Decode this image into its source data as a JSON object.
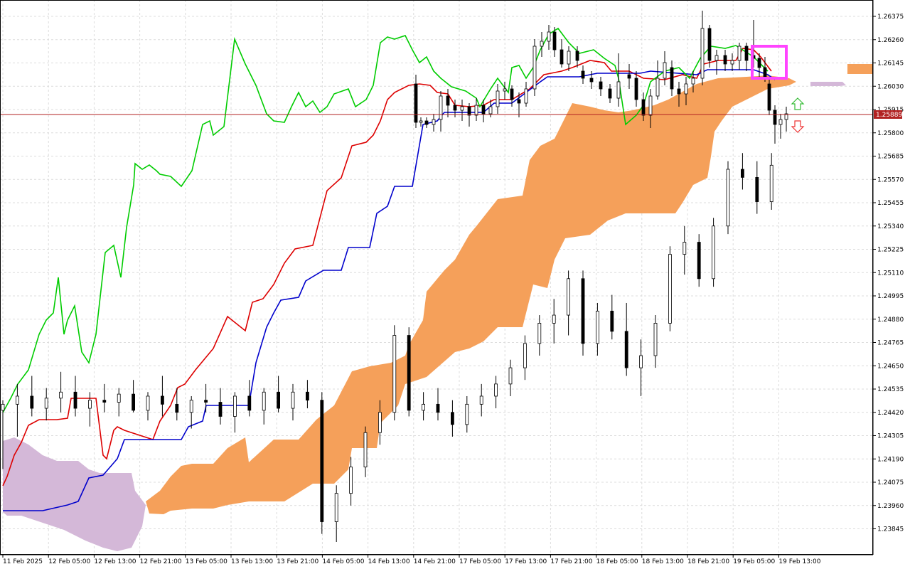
{
  "chart_data": {
    "type": "candlestick",
    "indicator": "ichimoku",
    "y_axis": {
      "ticks": [
        "1.26375",
        "1.26260",
        "1.26145",
        "1.26030",
        "1.25915",
        "1.25800",
        "1.25685",
        "1.25570",
        "1.25455",
        "1.25340",
        "1.25225",
        "1.25110",
        "1.24995",
        "1.24880",
        "1.24765",
        "1.24650",
        "1.24535",
        "1.24420",
        "1.24305",
        "1.24190",
        "1.24075",
        "1.23960",
        "1.23845"
      ],
      "range": [
        1.2376,
        1.2644
      ]
    },
    "x_axis": {
      "ticks": [
        "11 Feb 2025",
        "12 Feb 05:00",
        "12 Feb 13:00",
        "12 Feb 21:00",
        "13 Feb 05:00",
        "13 Feb 13:00",
        "13 Feb 21:00",
        "14 Feb 05:00",
        "14 Feb 13:00",
        "14 Feb 21:00",
        "17 Feb 05:00",
        "17 Feb 13:00",
        "17 Feb 21:00",
        "18 Feb 05:00",
        "18 Feb 13:00",
        "18 Feb 21:00",
        "19 Feb 05:00",
        "19 Feb 13:00"
      ],
      "bars": 220
    },
    "current_price": "1.25889",
    "grid": true,
    "colors": {
      "kumo_bull": "#f5a05a",
      "kumo_bear": "#d4b8d8",
      "tenkan": "#dd0000",
      "kijun": "#0000cc",
      "chikou": "#00cc00",
      "price_line": "#b22222",
      "candle_up": "#ffffff",
      "candle_down": "#000000",
      "highlight_box": "#ff44ff",
      "arrow_up": "#33bb33",
      "arrow_down": "#ee3333"
    },
    "candles": [
      {
        "t": 0,
        "o": 1.2443,
        "h": 1.2448,
        "l": 1.2414,
        "c": 1.2446
      },
      {
        "t": 4,
        "o": 1.2446,
        "h": 1.2456,
        "l": 1.243,
        "c": 1.245
      },
      {
        "t": 8,
        "o": 1.245,
        "h": 1.246,
        "l": 1.244,
        "c": 1.2444
      },
      {
        "t": 12,
        "o": 1.2444,
        "h": 1.2454,
        "l": 1.2438,
        "c": 1.2449
      },
      {
        "t": 16,
        "o": 1.2449,
        "h": 1.2462,
        "l": 1.2442,
        "c": 1.2452
      },
      {
        "t": 20,
        "o": 1.2452,
        "h": 1.246,
        "l": 1.244,
        "c": 1.2444
      },
      {
        "t": 24,
        "o": 1.2444,
        "h": 1.2452,
        "l": 1.2435,
        "c": 1.2448
      },
      {
        "t": 28,
        "o": 1.2448,
        "h": 1.2456,
        "l": 1.2442,
        "c": 1.2447
      },
      {
        "t": 32,
        "o": 1.2447,
        "h": 1.2454,
        "l": 1.244,
        "c": 1.2451
      },
      {
        "t": 36,
        "o": 1.2451,
        "h": 1.2458,
        "l": 1.2442,
        "c": 1.2443
      },
      {
        "t": 40,
        "o": 1.2443,
        "h": 1.2452,
        "l": 1.2438,
        "c": 1.245
      },
      {
        "t": 44,
        "o": 1.245,
        "h": 1.246,
        "l": 1.244,
        "c": 1.2446
      },
      {
        "t": 48,
        "o": 1.2446,
        "h": 1.2454,
        "l": 1.2438,
        "c": 1.2442
      },
      {
        "t": 52,
        "o": 1.2442,
        "h": 1.245,
        "l": 1.2434,
        "c": 1.2448
      },
      {
        "t": 56,
        "o": 1.2448,
        "h": 1.2456,
        "l": 1.2442,
        "c": 1.2447
      },
      {
        "t": 60,
        "o": 1.2447,
        "h": 1.2454,
        "l": 1.2436,
        "c": 1.244
      },
      {
        "t": 64,
        "o": 1.244,
        "h": 1.2452,
        "l": 1.2432,
        "c": 1.245
      },
      {
        "t": 68,
        "o": 1.245,
        "h": 1.2458,
        "l": 1.244,
        "c": 1.2443
      },
      {
        "t": 72,
        "o": 1.2443,
        "h": 1.2454,
        "l": 1.2436,
        "c": 1.2452
      },
      {
        "t": 76,
        "o": 1.2452,
        "h": 1.246,
        "l": 1.2442,
        "c": 1.2444
      },
      {
        "t": 80,
        "o": 1.2444,
        "h": 1.2456,
        "l": 1.2438,
        "c": 1.2452
      },
      {
        "t": 84,
        "o": 1.2452,
        "h": 1.2458,
        "l": 1.2444,
        "c": 1.2448
      },
      {
        "t": 88,
        "o": 1.2448,
        "h": 1.2452,
        "l": 1.2382,
        "c": 1.2388
      },
      {
        "t": 92,
        "o": 1.2388,
        "h": 1.2406,
        "l": 1.2378,
        "c": 1.2402
      },
      {
        "t": 96,
        "o": 1.2402,
        "h": 1.242,
        "l": 1.2396,
        "c": 1.2415
      },
      {
        "t": 100,
        "o": 1.2415,
        "h": 1.2435,
        "l": 1.241,
        "c": 1.2432
      },
      {
        "t": 104,
        "o": 1.2432,
        "h": 1.2448,
        "l": 1.2426,
        "c": 1.2442
      },
      {
        "t": 108,
        "o": 1.2442,
        "h": 1.2485,
        "l": 1.2438,
        "c": 1.248
      },
      {
        "t": 112,
        "o": 1.248,
        "h": 1.2484,
        "l": 1.244,
        "c": 1.2443
      },
      {
        "t": 116,
        "o": 1.2443,
        "h": 1.2452,
        "l": 1.2438,
        "c": 1.2446
      },
      {
        "t": 120,
        "o": 1.2446,
        "h": 1.2454,
        "l": 1.2438,
        "c": 1.2442
      },
      {
        "t": 124,
        "o": 1.2442,
        "h": 1.2448,
        "l": 1.243,
        "c": 1.2436
      },
      {
        "t": 128,
        "o": 1.2436,
        "h": 1.245,
        "l": 1.2432,
        "c": 1.2446
      },
      {
        "t": 132,
        "o": 1.2446,
        "h": 1.2456,
        "l": 1.244,
        "c": 1.245
      },
      {
        "t": 136,
        "o": 1.245,
        "h": 1.246,
        "l": 1.2444,
        "c": 1.2456
      },
      {
        "t": 140,
        "o": 1.2456,
        "h": 1.2468,
        "l": 1.245,
        "c": 1.2464
      },
      {
        "t": 144,
        "o": 1.2464,
        "h": 1.248,
        "l": 1.2458,
        "c": 1.2476
      },
      {
        "t": 148,
        "o": 1.2476,
        "h": 1.249,
        "l": 1.247,
        "c": 1.2486
      },
      {
        "t": 152,
        "o": 1.2486,
        "h": 1.2498,
        "l": 1.2476,
        "c": 1.249
      },
      {
        "t": 156,
        "o": 1.249,
        "h": 1.2512,
        "l": 1.248,
        "c": 1.2508
      },
      {
        "t": 160,
        "o": 1.2508,
        "h": 1.2512,
        "l": 1.247,
        "c": 1.2476
      },
      {
        "t": 164,
        "o": 1.2476,
        "h": 1.2496,
        "l": 1.247,
        "c": 1.2492
      },
      {
        "t": 168,
        "o": 1.2492,
        "h": 1.25,
        "l": 1.2478,
        "c": 1.2482
      },
      {
        "t": 172,
        "o": 1.2482,
        "h": 1.2496,
        "l": 1.246,
        "c": 1.2464
      },
      {
        "t": 176,
        "o": 1.2464,
        "h": 1.2478,
        "l": 1.245,
        "c": 1.247
      },
      {
        "t": 180,
        "o": 1.247,
        "h": 1.249,
        "l": 1.2464,
        "c": 1.2486
      },
      {
        "t": 184,
        "o": 1.2486,
        "h": 1.2524,
        "l": 1.2482,
        "c": 1.252
      },
      {
        "t": 188,
        "o": 1.252,
        "h": 1.2534,
        "l": 1.251,
        "c": 1.2526
      },
      {
        "t": 192,
        "o": 1.2526,
        "h": 1.253,
        "l": 1.2504,
        "c": 1.2508
      },
      {
        "t": 196,
        "o": 1.2508,
        "h": 1.2538,
        "l": 1.2504,
        "c": 1.2534
      },
      {
        "t": 200,
        "o": 1.2534,
        "h": 1.2566,
        "l": 1.253,
        "c": 1.2562
      },
      {
        "t": 204,
        "o": 1.2562,
        "h": 1.257,
        "l": 1.2552,
        "c": 1.2558
      },
      {
        "t": 208,
        "o": 1.2558,
        "h": 1.2566,
        "l": 1.254,
        "c": 1.2546
      },
      {
        "t": 212,
        "o": 1.2546,
        "h": 1.257,
        "l": 1.2542,
        "c": 1.2564
      }
    ]
  }
}
